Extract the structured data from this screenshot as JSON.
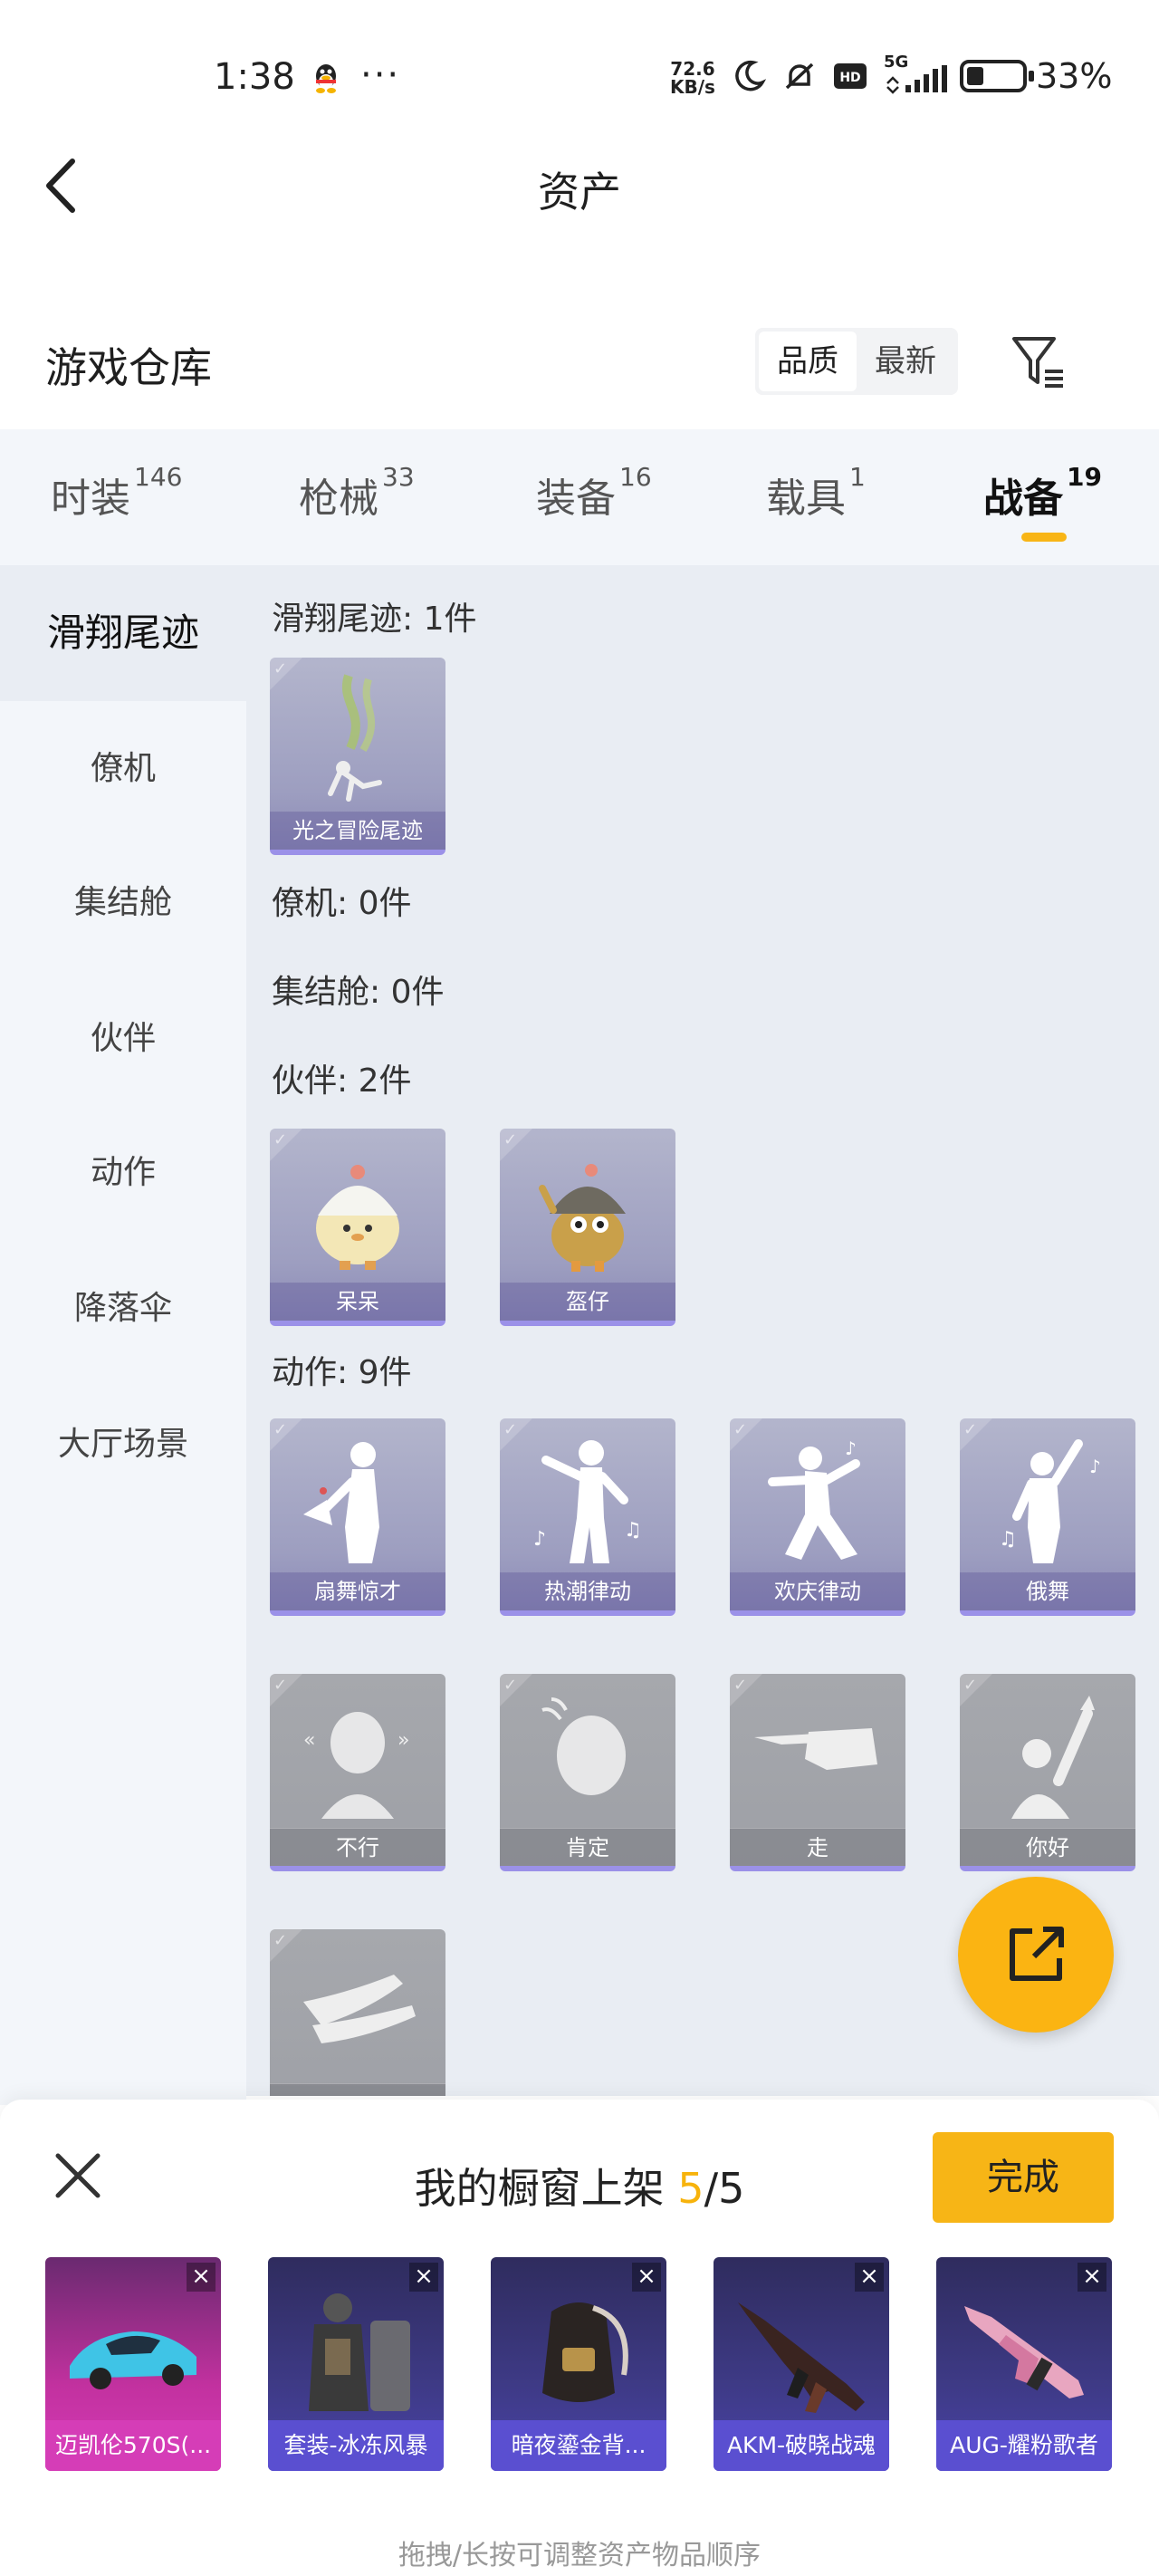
{
  "status_bar": {
    "time": "1:38",
    "speed_value": "72.6",
    "speed_unit": "KB/s",
    "network": "5G",
    "battery_pct": "33%",
    "battery_level": 0.33
  },
  "nav": {
    "title": "资产"
  },
  "warehouse": {
    "title": "游戏仓库",
    "sort_options": [
      "品质",
      "最新"
    ],
    "sort_active": "品质"
  },
  "tabs": [
    {
      "label": "时装",
      "count": "146"
    },
    {
      "label": "枪械",
      "count": "33"
    },
    {
      "label": "装备",
      "count": "16"
    },
    {
      "label": "载具",
      "count": "1"
    },
    {
      "label": "战备",
      "count": "19"
    }
  ],
  "sidebar": {
    "items": [
      "滑翔尾迹",
      "僚机",
      "集结舱",
      "伙伴",
      "动作",
      "降落伞",
      "大厅场景"
    ]
  },
  "content": {
    "sections": [
      {
        "title": "滑翔尾迹: 1件",
        "items": [
          "光之冒险尾迹"
        ]
      },
      {
        "title": "僚机: 0件",
        "items": []
      },
      {
        "title": "集结舱: 0件",
        "items": []
      },
      {
        "title": "伙伴: 2件",
        "items": [
          "呆呆",
          "盔仔"
        ]
      },
      {
        "title": "动作: 9件",
        "items": [
          "扇舞惊才",
          "热潮律动",
          "欢庆律动",
          "俄舞",
          "不行",
          "肯定",
          "走",
          "你好",
          ""
        ]
      }
    ]
  },
  "panel": {
    "title_prefix": "我的橱窗上架 ",
    "current": "5",
    "separator": "/",
    "total": "5",
    "done_label": "完成",
    "items": [
      "迈凯伦570S(...",
      "套装-冰冻风暴",
      "暗夜鎏金背...",
      "AKM-破晓战魂",
      "AUG-耀粉歌者"
    ],
    "hint": "拖拽/长按可调整资产物品顺序"
  }
}
